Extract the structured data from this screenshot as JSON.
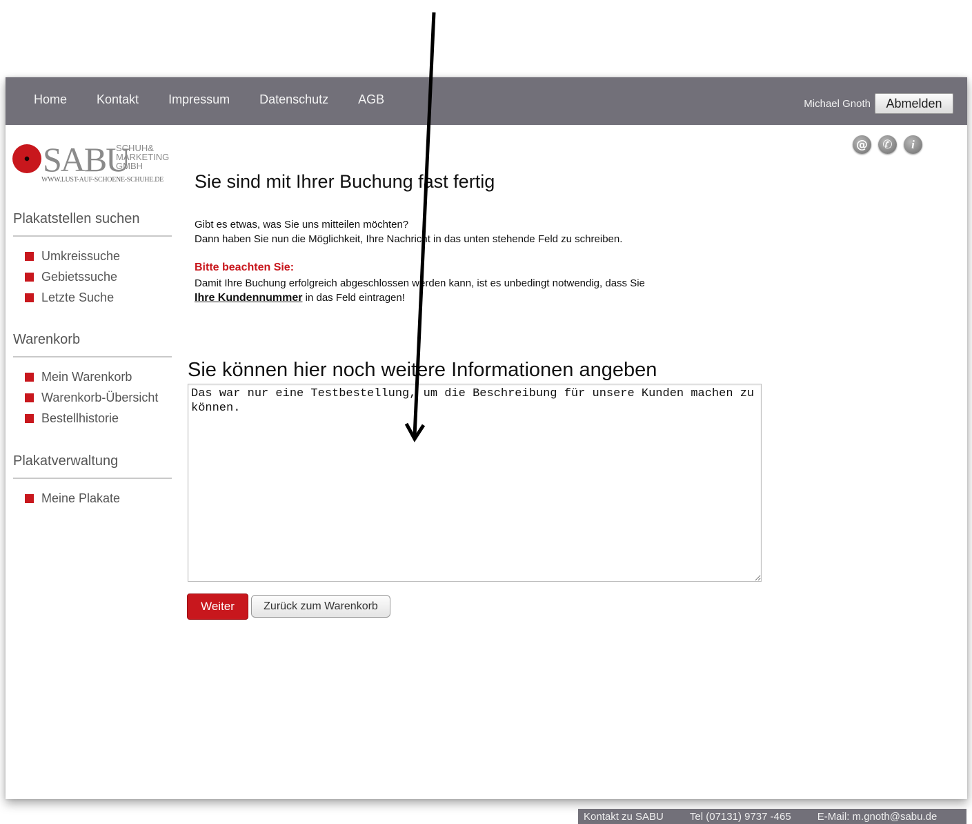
{
  "nav": {
    "items": [
      "Home",
      "Kontakt",
      "Impressum",
      "Datenschutz",
      "AGB"
    ]
  },
  "user": {
    "name": "Michael Gnoth",
    "logout_label": "Abmelden"
  },
  "logo": {
    "brand": "SABU",
    "subtitle_1": "SCHUH&",
    "subtitle_2": "MARKETING",
    "subtitle_3": "GMBH",
    "url": "WWW.LUST-AUF-SCHOENE-SCHUHE.DE"
  },
  "sidebar": {
    "sections": [
      {
        "title": "Plakatstellen suchen",
        "items": [
          "Umkreissuche",
          "Gebietssuche",
          "Letzte Suche"
        ]
      },
      {
        "title": "Warenkorb",
        "items": [
          "Mein Warenkorb",
          "Warenkorb-Übersicht",
          "Bestellhistorie"
        ]
      },
      {
        "title": "Plakatverwaltung",
        "items": [
          "Meine Plakate"
        ]
      }
    ]
  },
  "contact_icons": [
    "email-icon",
    "phone-icon",
    "info-icon"
  ],
  "main": {
    "title": "Sie sind mit Ihrer Buchung fast fertig",
    "intro_line1": "Gibt es etwas, was Sie uns mitteilen möchten?",
    "intro_line2": "Dann haben Sie nun die Möglichkeit, Ihre Nachricht in das unten stehende Feld zu schreiben.",
    "note_title": "Bitte beachten Sie:",
    "note_line1": "Damit Ihre Buchung erfolgreich abgeschlossen werden kann, ist es unbedingt notwendig, dass Sie",
    "note_link": "Ihre Kundennummer",
    "note_line2_rest": " in das Feld eintragen!",
    "section_title": "Sie können hier noch weitere Informationen angeben",
    "textarea_value": "Das war nur eine Testbestellung, um die Beschreibung für unsere Kunden machen zu können.",
    "next_label": "Weiter",
    "back_label": "Zurück zum Warenkorb"
  },
  "footer": {
    "contact": "Kontakt zu SABU",
    "phone": "Tel (07131) 9737 -465",
    "email": "E-Mail: m.gnoth@sabu.de"
  }
}
